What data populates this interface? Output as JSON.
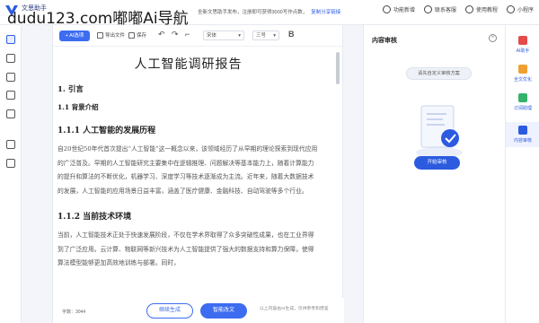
{
  "app": {
    "name": "文思助手",
    "watermark": "dudu123.com嘟嘟Ai导航"
  },
  "announcement": {
    "text": "全新文思助手发布，注册即可获得3000写作点数，",
    "link": "复制分享链接"
  },
  "top_nav": [
    {
      "label": "功能新增"
    },
    {
      "label": "联系客服"
    },
    {
      "label": "使用教程"
    },
    {
      "label": "小程序"
    }
  ],
  "toolbar": {
    "ai_label": "+ AI选项",
    "export_label": "导出文件",
    "save_label": "保存",
    "font_value": "宋体",
    "size_value": "三号"
  },
  "document": {
    "title": "人工智能调研报告",
    "section_1": "1. 引言",
    "section_1_1": "1.1 背景介绍",
    "section_1_1_1": "1.1.1 人工智能的发展历程",
    "paragraph_1": "自20世纪50年代首次提出“人工智能”这一概念以来，该领域经历了从早期的理论探索到现代应用的广泛普及。早期的人工智能研究主要集中在逻辑推理、问题解决等基本能力上，随着计算能力的提升和算法的不断优化，机器学习、深度学习等技术逐渐成为主流。近年来，随着大数据技术的发展，人工智能的应用场景日益丰富，涵盖了医疗健康、金融科技、自动驾驶等多个行业。",
    "section_1_1_2": "1.1.2 当前技术环境",
    "paragraph_2": "当前，人工智能技术正处于快速发展阶段，不仅在学术界取得了众多突破性成果，也在工业界得到了广泛应用。云计算、物联网等新兴技术为人工智能提供了强大的数据支持和算力保障，使得算法模型能够更加高效地训练与部署。同时，"
  },
  "footer": {
    "word_count": "字数：3044",
    "continue_label": "继续生成",
    "polish_label": "智能改文",
    "note": "以上内容由AI生成，仅供参考和借鉴"
  },
  "review_panel": {
    "title": "内容审核",
    "close_icon": "close-icon",
    "pill_text": "请先自定义审核方案",
    "start_label": "开始审核"
  },
  "right_tools": [
    {
      "label": "AI助手"
    },
    {
      "label": "全文优化"
    },
    {
      "label": "订阅助理"
    },
    {
      "label": "内容审核"
    }
  ],
  "colors": {
    "accent": "#2c5be0",
    "background": "#f3f5fa"
  }
}
